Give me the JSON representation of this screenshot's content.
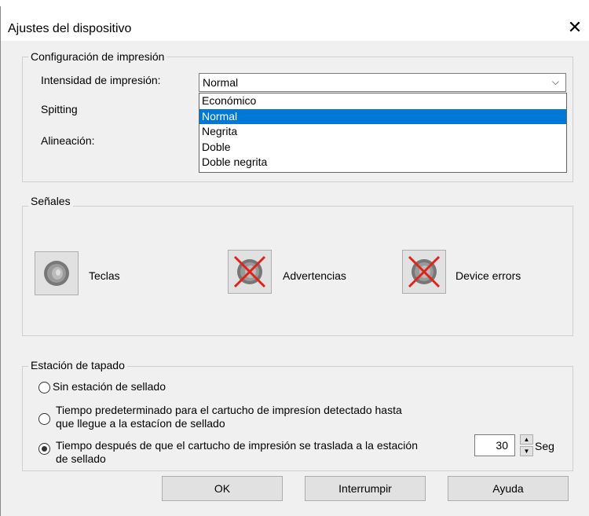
{
  "window": {
    "title": "Ajustes del dispositivo"
  },
  "print_config": {
    "legend": "Configuración de impresión",
    "intensity_label": "Intensidad de impresión:",
    "spitting_label": "Spitting",
    "alignment_label": "Alineación:",
    "combo_value": "Normal",
    "options": [
      "Económico",
      "Normal",
      "Negrita",
      "Doble",
      "Doble negrita"
    ],
    "selected_index": 1
  },
  "signals": {
    "legend": "Señales",
    "items": [
      {
        "label": "Teclas",
        "icon": "speaker-icon",
        "muted": false
      },
      {
        "label": "Advertencias",
        "icon": "speaker-muted-icon",
        "muted": true
      },
      {
        "label": "Device errors",
        "icon": "speaker-muted-icon",
        "muted": true
      }
    ]
  },
  "capping": {
    "legend": "Estación de tapado",
    "options": [
      {
        "line1": "Sin estación de sellado",
        "line2": "",
        "checked": false
      },
      {
        "line1": "Tiempo predeterminado para el cartucho de impresíon detectado hasta",
        "line2": "que llegue a la estacíon de sellado",
        "checked": false
      },
      {
        "line1": "Tiempo después de que el cartucho de impresión se traslada a la estación",
        "line2": "de sellado",
        "checked": true
      }
    ],
    "seconds_value": "30",
    "seconds_unit": "Seg"
  },
  "buttons": {
    "ok": "OK",
    "cancel": "Interrumpir",
    "help": "Ayuda"
  }
}
